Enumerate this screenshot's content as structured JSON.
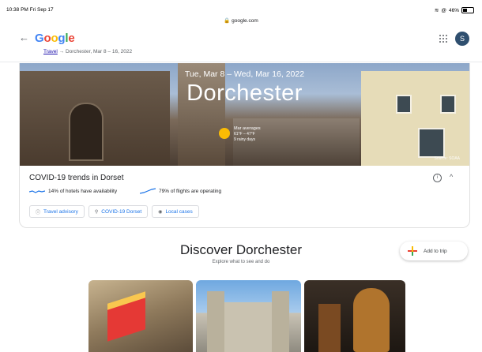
{
  "status_bar": {
    "time": "10:38 PM  Fri Sep 17",
    "url": "google.com",
    "battery": "46%"
  },
  "header": {
    "back_icon": "arrow-left-icon",
    "logo": "Google",
    "breadcrumb_link": "Travel",
    "breadcrumb_arrow": "→",
    "breadcrumb_rest": "Dorchester, Mar 8 – 16, 2022",
    "avatar_letter": "S"
  },
  "hero": {
    "dates": "Tue, Mar 8 – Wed, Mar 16, 2022",
    "city": "Dorchester",
    "weather_title": "Mar averages",
    "weather_temps": "61°F – 47°F",
    "weather_days": "9 rainy days",
    "source": "Source: SOAA"
  },
  "covid": {
    "title": "COVID-19 trends in Dorset",
    "hotels": "14% of hotels have availability",
    "flights": "79% of flights are operating",
    "chips": [
      {
        "icon": "info-icon",
        "label": "Travel advisory"
      },
      {
        "icon": "search-icon",
        "label": "COVID-19 Dorset"
      },
      {
        "icon": "globe-icon",
        "label": "Local cases"
      }
    ],
    "info_glyph": "i",
    "collapse_glyph": "^"
  },
  "discover": {
    "title": "Discover Dorchester",
    "subtitle": "Explore what to see and do",
    "add_to_trip": "Add to trip"
  },
  "colors": {
    "link": "#1a0dab",
    "chip_text": "#1a73e8",
    "sun": "#fbbc04"
  }
}
